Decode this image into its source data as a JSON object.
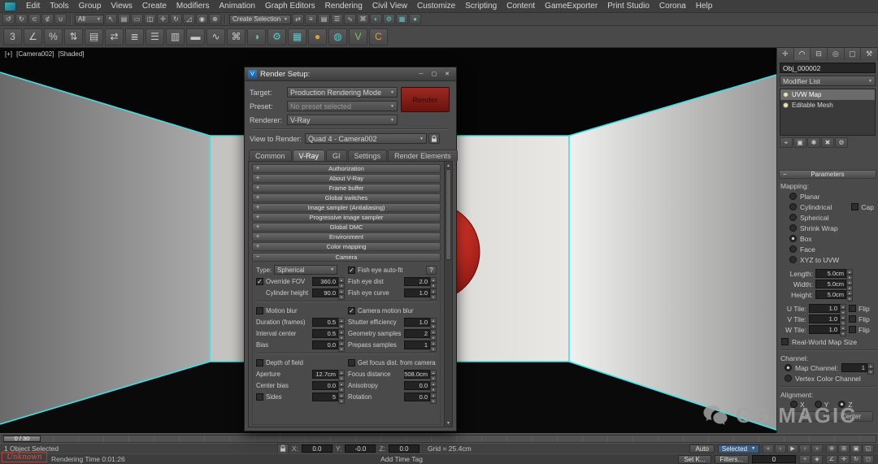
{
  "menu": {
    "items": [
      "Edit",
      "Tools",
      "Group",
      "Views",
      "Create",
      "Modifiers",
      "Animation",
      "Graph Editors",
      "Rendering",
      "Civil View",
      "Customize",
      "Scripting",
      "Content",
      "GameExporter",
      "Print Studio",
      "Corona",
      "Help"
    ]
  },
  "toolbar1": {
    "filter_value": "All",
    "selection_set_value": "Create Selection S",
    "icons_a": [
      {
        "name": "undo-icon",
        "glyph": "↺"
      },
      {
        "name": "redo-icon",
        "glyph": "↻"
      },
      {
        "name": "select-and-link-icon",
        "glyph": "⊂"
      },
      {
        "name": "unlink-selection-icon",
        "glyph": "⊄"
      },
      {
        "name": "bind-to-space-warp-icon",
        "glyph": "∪"
      }
    ],
    "icons_b": [
      {
        "name": "select-object-icon",
        "glyph": "↖"
      },
      {
        "name": "select-by-name-icon",
        "glyph": "▤"
      },
      {
        "name": "selection-region-icon",
        "glyph": "▭"
      },
      {
        "name": "window-crossing-icon",
        "glyph": "◫"
      },
      {
        "name": "select-and-move-icon",
        "glyph": "✛"
      },
      {
        "name": "select-and-rotate-icon",
        "glyph": "↻"
      },
      {
        "name": "select-and-scale-icon",
        "glyph": "◿"
      },
      {
        "name": "use-center-icon",
        "glyph": "◉"
      },
      {
        "name": "select-and-manipulate-icon",
        "glyph": "⊕"
      }
    ],
    "icons_c": [
      {
        "name": "mirror-icon",
        "glyph": "⇄"
      },
      {
        "name": "align-icon",
        "glyph": "≡"
      },
      {
        "name": "layer-manager-icon",
        "glyph": "▤"
      },
      {
        "name": "scene-explorer-icon",
        "glyph": "☰"
      },
      {
        "name": "curve-editor-icon",
        "glyph": "∿"
      },
      {
        "name": "schematic-view-icon",
        "glyph": "⌘"
      },
      {
        "name": "material-editor-icon",
        "glyph": "◐",
        "cls": "teal"
      },
      {
        "name": "render-setup-icon",
        "glyph": "⚙",
        "cls": "teal"
      },
      {
        "name": "rendered-frame-icon",
        "glyph": "▦",
        "cls": "teal"
      },
      {
        "name": "render-production-icon",
        "glyph": "●",
        "cls": "teal"
      }
    ]
  },
  "toolbar2": {
    "icons": [
      {
        "name": "snap-toggle-3d-icon",
        "glyph": "3"
      },
      {
        "name": "angle-snap-icon",
        "glyph": "∠"
      },
      {
        "name": "percent-snap-icon",
        "glyph": "%"
      },
      {
        "name": "spinner-snap-icon",
        "glyph": "⇅"
      },
      {
        "name": "edit-named-selections-icon",
        "glyph": "▤"
      },
      {
        "name": "mirror-tool-icon",
        "glyph": "⇄"
      },
      {
        "name": "align-tool-icon",
        "glyph": "≣"
      },
      {
        "name": "toggle-scene-explorer-icon",
        "glyph": "☰"
      },
      {
        "name": "toggle-layer-explorer-icon",
        "glyph": "▥"
      },
      {
        "name": "toggle-ribbon-icon",
        "glyph": "▬"
      },
      {
        "name": "curve-editor-2-icon",
        "glyph": "∿"
      },
      {
        "name": "schematic-view-2-icon",
        "glyph": "⌘"
      },
      {
        "name": "material-editor-2-icon",
        "glyph": "◑",
        "cls": "teal"
      },
      {
        "name": "render-setup-2-icon",
        "glyph": "⚙",
        "cls": "teal"
      },
      {
        "name": "rendered-frame-2-icon",
        "glyph": "▦",
        "cls": "teal"
      },
      {
        "name": "render-production-2-icon",
        "glyph": "●",
        "cls": "orange"
      },
      {
        "name": "render-iterative-icon",
        "glyph": "◍",
        "cls": "teal"
      },
      {
        "name": "vray-toolbar-icon",
        "glyph": "V",
        "cls": "green"
      },
      {
        "name": "corona-toolbar-icon",
        "glyph": "C",
        "cls": "orange"
      }
    ]
  },
  "viewport": {
    "label_plus": "[+]",
    "label_camera": "[Camera002]",
    "label_shading": "[Shaded]"
  },
  "dialog": {
    "title": "Render Setup:",
    "expand_glyph": "+",
    "collapse_glyph": "−",
    "titlebar": {
      "minimize": "─",
      "maximize": "▢",
      "close": "✕"
    },
    "target_label": "Target:",
    "target_value": "Production Rendering Mode",
    "preset_label": "Preset:",
    "preset_value": "No preset selected",
    "renderer_label": "Renderer:",
    "renderer_value": "V-Ray",
    "view_label": "View to Render:",
    "view_value": "Quad 4 - Camera002",
    "render_button": "Render",
    "tabs": [
      {
        "label": "Common",
        "name": "tab-common"
      },
      {
        "label": "V-Ray",
        "cls": "active",
        "name": "tab-vray"
      },
      {
        "label": "GI",
        "name": "tab-gi"
      },
      {
        "label": "Settings",
        "name": "tab-settings"
      },
      {
        "label": "Render Elements",
        "name": "tab-render-elements"
      }
    ],
    "rollouts": [
      "Authorization",
      "About V-Ray",
      "Frame buffer",
      "Global switches",
      "Image sampler (Antialiasing)",
      "Progressive image sampler",
      "Global DMC",
      "Environment",
      "Color mapping"
    ],
    "camera": {
      "header": "Camera",
      "type_label": "Type:",
      "type_value": "Spherical",
      "help_button": "?",
      "override_fov_label": "Override FOV",
      "override_fov_value": "360.0",
      "cylinder_height_label": "Cylinder height",
      "cylinder_height_value": "90.0",
      "fish_eye_autofit_label": "Fish eye auto-fit",
      "fish_eye_dist_label": "Fish eye dist",
      "fish_eye_dist_value": "2.0",
      "fish_eye_curve_label": "Fish eye curve",
      "fish_eye_curve_value": "1.0",
      "motion_blur_label": "Motion blur",
      "camera_motion_blur_label": "Camera motion blur",
      "duration_label": "Duration (frames)",
      "duration_value": "0.5",
      "shutter_label": "Shutter efficiency",
      "shutter_value": "1.0",
      "interval_label": "Interval center",
      "interval_value": "0.5",
      "geometry_samples_label": "Geometry samples",
      "geometry_samples_value": "2",
      "bias_label": "Bias",
      "bias_value": "0.0",
      "prepass_label": "Prepass samples",
      "prepass_value": "1",
      "dof_label": "Depth of field",
      "get_focus_label": "Get focus dist. from camera",
      "aperture_label": "Aperture",
      "aperture_value": "12.7cm",
      "focus_label": "Focus distance",
      "focus_value": "508.0cm",
      "center_bias_label": "Center bias",
      "center_bias_value": "0.0",
      "anisotropy_label": "Anisotropy",
      "anisotropy_value": "0.0",
      "sides_label": "Sides",
      "sides_value": "5",
      "rotation_label": "Rotation",
      "rotation_value": "0.0"
    }
  },
  "command_panel": {
    "tabs": [
      {
        "name": "panel-tab-create",
        "glyph": "✛"
      },
      {
        "name": "panel-tab-modify",
        "glyph": "◠",
        "cls": "active"
      },
      {
        "name": "panel-tab-hierarchy",
        "glyph": "⊟"
      },
      {
        "name": "panel-tab-motion",
        "glyph": "◎"
      },
      {
        "name": "panel-tab-display",
        "glyph": "▢"
      },
      {
        "name": "panel-tab-utilities",
        "glyph": "⚒"
      }
    ],
    "object_name": "Obj_000002",
    "modifier_list_label": "Modifier List",
    "stack": [
      {
        "label": "UVW Map",
        "cls": "selected",
        "name": "stack-item-uvw-map"
      },
      {
        "label": "Editable Mesh",
        "name": "stack-item-editable-mesh"
      }
    ],
    "stack_buttons": [
      {
        "name": "pin-stack-icon",
        "glyph": "⌖"
      },
      {
        "name": "show-end-result-icon",
        "glyph": "▣"
      },
      {
        "name": "make-unique-icon",
        "glyph": "✱"
      },
      {
        "name": "remove-modifier-icon",
        "glyph": "✖"
      },
      {
        "name": "configure-modifier-sets-icon",
        "glyph": "⚙"
      }
    ],
    "parameters_header": "Parameters",
    "mapping_label": "Mapping:",
    "cap_label": "Cap",
    "mapping_options": [
      {
        "label": "Planar",
        "name": "mapping-planar"
      },
      {
        "label": "Cylindrical",
        "name": "mapping-cylindrical"
      },
      {
        "label": "Spherical",
        "name": "mapping-spherical"
      },
      {
        "label": "Shrink Wrap",
        "name": "mapping-shrink-wrap"
      },
      {
        "label": "Box",
        "cls": "on",
        "name": "mapping-box"
      },
      {
        "label": "Face",
        "name": "mapping-face"
      },
      {
        "label": "XYZ to UVW",
        "name": "mapping-xyz-to-uvw"
      }
    ],
    "dims": [
      {
        "label": "Length:",
        "value": "5.0cm",
        "name": "length-row"
      },
      {
        "label": "Width:",
        "value": "5.0cm",
        "name": "width-row"
      },
      {
        "label": "Height:",
        "value": "5.0cm",
        "name": "height-row"
      }
    ],
    "tiles": [
      {
        "label": "U Tile:",
        "value": "1.0",
        "flip": "Flip",
        "name": "u-tile-row"
      },
      {
        "label": "V Tile:",
        "value": "1.0",
        "flip": "Flip",
        "name": "v-tile-row"
      },
      {
        "label": "W Tile:",
        "value": "1.0",
        "flip": "Flip",
        "name": "w-tile-row"
      }
    ],
    "real_world_label": "Real-World Map Size",
    "channel_label": "Channel:",
    "map_channel_label": "Map Channel:",
    "map_channel_value": "1",
    "vertex_color_label": "Vertex Color Channel",
    "alignment_label": "Alignment:",
    "axes": [
      {
        "label": "X",
        "name": "align-x"
      },
      {
        "label": "Y",
        "name": "align-y"
      },
      {
        "label": "Z",
        "cls": "on",
        "name": "align-z"
      }
    ],
    "align_buttons": [
      {
        "label": "Fit",
        "name": "fit-button"
      },
      {
        "label": "Center",
        "name": "center-button"
      }
    ]
  },
  "timeline": {
    "slider": "0 / 30"
  },
  "status": {
    "selected_text": "1 Object Selected",
    "x_label": "X:",
    "x_value": "0.0",
    "y_label": "Y:",
    "y_value": "-0.0",
    "z_label": "Z:",
    "z_value": "0.0",
    "grid_text": "Grid = 25.4cm",
    "auto_label": "Auto",
    "auto_mode": "Selected",
    "set_key_label": "Set K...",
    "filters_label": "Filters...",
    "frame_value": "0",
    "prompt": "Rendering Time  0:01:26",
    "add_time_tag": "Add Time Tag",
    "transport": [
      {
        "glyph": "«",
        "name": "goto-start-icon"
      },
      {
        "glyph": "‹",
        "name": "prev-frame-icon"
      },
      {
        "glyph": "▶",
        "name": "play-icon"
      },
      {
        "glyph": "›",
        "name": "next-frame-icon"
      },
      {
        "glyph": "»",
        "name": "goto-end-icon"
      }
    ],
    "key_icons": [
      {
        "glyph": "+",
        "name": "set-key-icon"
      },
      {
        "glyph": "◈",
        "name": "key-mode-icon"
      }
    ],
    "nav_row1": [
      {
        "glyph": "⊕",
        "name": "zoom-icon"
      },
      {
        "glyph": "⊞",
        "name": "zoom-all-icon"
      },
      {
        "glyph": "▣",
        "name": "zoom-extents-icon"
      },
      {
        "glyph": "◱",
        "name": "zoom-region-icon"
      }
    ],
    "nav_row2": [
      {
        "glyph": "∠",
        "name": "fov-icon"
      },
      {
        "glyph": "✛",
        "name": "pan-icon"
      },
      {
        "glyph": "↻",
        "name": "orbit-icon"
      },
      {
        "glyph": "◻",
        "name": "maximize-viewport-icon"
      }
    ]
  },
  "watermark": {
    "unknown": "Unknown",
    "brand": "CG MAGIC"
  }
}
